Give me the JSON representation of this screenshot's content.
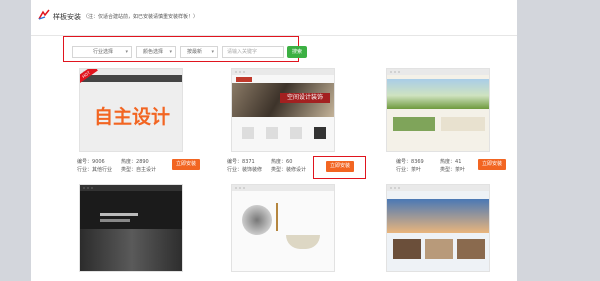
{
  "header": {
    "title": "样板安装",
    "subtitle": "（注：仅适合建站前，如已安装请慎重安装样板！）"
  },
  "filters": {
    "industry": "行业选择",
    "color": "颜色选择",
    "sort": "按最新",
    "search_placeholder": "请输入关键字",
    "search_button": "搜索"
  },
  "templates": [
    {
      "thumb_text": "自主设计",
      "badge": "HOT",
      "id_label": "编号：",
      "id": "9006",
      "hits_label": "热度：",
      "hits": "2890",
      "industry_label": "行业：",
      "industry": "其他行业",
      "style_label": "类型：",
      "style": "自主设计",
      "button": "立即安装"
    },
    {
      "thumb_text": "空间设计装饰",
      "id_label": "编号：",
      "id": "8371",
      "hits_label": "热度：",
      "hits": "60",
      "industry_label": "行业：",
      "industry": "装饰装修",
      "style_label": "类型：",
      "style": "装修设计",
      "button": "立即安装"
    },
    {
      "thumb_text": "",
      "id_label": "编号：",
      "id": "8369",
      "hits_label": "热度：",
      "hits": "41",
      "industry_label": "行业：",
      "industry": "茶叶",
      "style_label": "类型：",
      "style": "茶叶",
      "button": "立即安装"
    },
    {
      "thumb_text": "",
      "id_label": "",
      "id": "",
      "hits_label": "",
      "hits": "",
      "industry_label": "",
      "industry": "",
      "style_label": "",
      "style": "",
      "button": ""
    },
    {
      "thumb_text": "",
      "id_label": "",
      "id": "",
      "hits_label": "",
      "hits": "",
      "industry_label": "",
      "industry": "",
      "style_label": "",
      "style": "",
      "button": ""
    },
    {
      "thumb_text": "",
      "id_label": "",
      "id": "",
      "hits_label": "",
      "hits": "",
      "industry_label": "",
      "industry": "",
      "style_label": "",
      "style": "",
      "button": ""
    }
  ],
  "colors": {
    "highlight": "#e0141e",
    "button": "#f26522",
    "search": "#3cb043"
  }
}
